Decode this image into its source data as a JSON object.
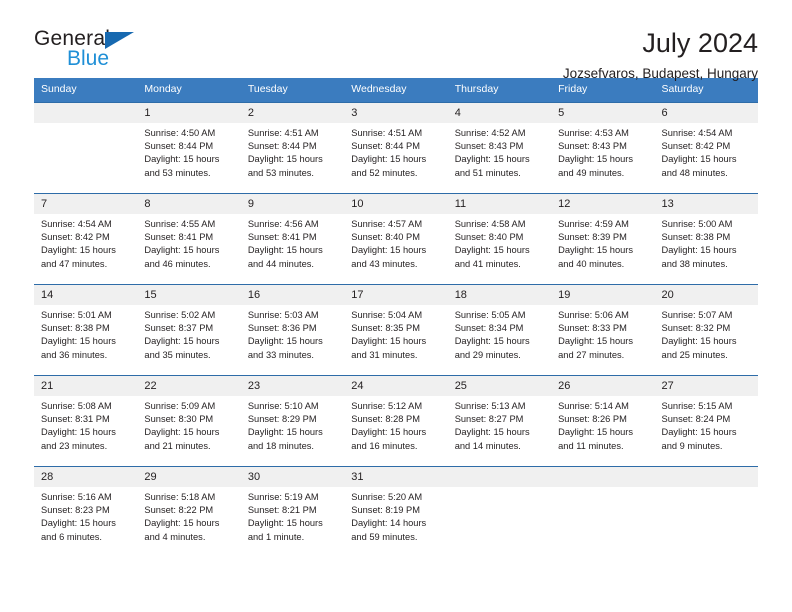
{
  "brand": {
    "name_top": "General",
    "name_bottom": "Blue",
    "accent_color": "#1769b0",
    "accent_color_light": "#1f8fd6"
  },
  "header": {
    "title": "July 2024",
    "subtitle": "Jozsefvaros, Budapest, Hungary"
  },
  "calendar": {
    "header_bg": "#3b7cbf",
    "daynum_bg": "#f0f0f0",
    "rule_color": "#2e6ca8",
    "weekdays": [
      "Sunday",
      "Monday",
      "Tuesday",
      "Wednesday",
      "Thursday",
      "Friday",
      "Saturday"
    ],
    "weeks": [
      [
        {
          "day": "",
          "sunrise": "",
          "sunset": "",
          "daylight1": "",
          "daylight2": ""
        },
        {
          "day": "1",
          "sunrise": "Sunrise: 4:50 AM",
          "sunset": "Sunset: 8:44 PM",
          "daylight1": "Daylight: 15 hours",
          "daylight2": "and 53 minutes."
        },
        {
          "day": "2",
          "sunrise": "Sunrise: 4:51 AM",
          "sunset": "Sunset: 8:44 PM",
          "daylight1": "Daylight: 15 hours",
          "daylight2": "and 53 minutes."
        },
        {
          "day": "3",
          "sunrise": "Sunrise: 4:51 AM",
          "sunset": "Sunset: 8:44 PM",
          "daylight1": "Daylight: 15 hours",
          "daylight2": "and 52 minutes."
        },
        {
          "day": "4",
          "sunrise": "Sunrise: 4:52 AM",
          "sunset": "Sunset: 8:43 PM",
          "daylight1": "Daylight: 15 hours",
          "daylight2": "and 51 minutes."
        },
        {
          "day": "5",
          "sunrise": "Sunrise: 4:53 AM",
          "sunset": "Sunset: 8:43 PM",
          "daylight1": "Daylight: 15 hours",
          "daylight2": "and 49 minutes."
        },
        {
          "day": "6",
          "sunrise": "Sunrise: 4:54 AM",
          "sunset": "Sunset: 8:42 PM",
          "daylight1": "Daylight: 15 hours",
          "daylight2": "and 48 minutes."
        }
      ],
      [
        {
          "day": "7",
          "sunrise": "Sunrise: 4:54 AM",
          "sunset": "Sunset: 8:42 PM",
          "daylight1": "Daylight: 15 hours",
          "daylight2": "and 47 minutes."
        },
        {
          "day": "8",
          "sunrise": "Sunrise: 4:55 AM",
          "sunset": "Sunset: 8:41 PM",
          "daylight1": "Daylight: 15 hours",
          "daylight2": "and 46 minutes."
        },
        {
          "day": "9",
          "sunrise": "Sunrise: 4:56 AM",
          "sunset": "Sunset: 8:41 PM",
          "daylight1": "Daylight: 15 hours",
          "daylight2": "and 44 minutes."
        },
        {
          "day": "10",
          "sunrise": "Sunrise: 4:57 AM",
          "sunset": "Sunset: 8:40 PM",
          "daylight1": "Daylight: 15 hours",
          "daylight2": "and 43 minutes."
        },
        {
          "day": "11",
          "sunrise": "Sunrise: 4:58 AM",
          "sunset": "Sunset: 8:40 PM",
          "daylight1": "Daylight: 15 hours",
          "daylight2": "and 41 minutes."
        },
        {
          "day": "12",
          "sunrise": "Sunrise: 4:59 AM",
          "sunset": "Sunset: 8:39 PM",
          "daylight1": "Daylight: 15 hours",
          "daylight2": "and 40 minutes."
        },
        {
          "day": "13",
          "sunrise": "Sunrise: 5:00 AM",
          "sunset": "Sunset: 8:38 PM",
          "daylight1": "Daylight: 15 hours",
          "daylight2": "and 38 minutes."
        }
      ],
      [
        {
          "day": "14",
          "sunrise": "Sunrise: 5:01 AM",
          "sunset": "Sunset: 8:38 PM",
          "daylight1": "Daylight: 15 hours",
          "daylight2": "and 36 minutes."
        },
        {
          "day": "15",
          "sunrise": "Sunrise: 5:02 AM",
          "sunset": "Sunset: 8:37 PM",
          "daylight1": "Daylight: 15 hours",
          "daylight2": "and 35 minutes."
        },
        {
          "day": "16",
          "sunrise": "Sunrise: 5:03 AM",
          "sunset": "Sunset: 8:36 PM",
          "daylight1": "Daylight: 15 hours",
          "daylight2": "and 33 minutes."
        },
        {
          "day": "17",
          "sunrise": "Sunrise: 5:04 AM",
          "sunset": "Sunset: 8:35 PM",
          "daylight1": "Daylight: 15 hours",
          "daylight2": "and 31 minutes."
        },
        {
          "day": "18",
          "sunrise": "Sunrise: 5:05 AM",
          "sunset": "Sunset: 8:34 PM",
          "daylight1": "Daylight: 15 hours",
          "daylight2": "and 29 minutes."
        },
        {
          "day": "19",
          "sunrise": "Sunrise: 5:06 AM",
          "sunset": "Sunset: 8:33 PM",
          "daylight1": "Daylight: 15 hours",
          "daylight2": "and 27 minutes."
        },
        {
          "day": "20",
          "sunrise": "Sunrise: 5:07 AM",
          "sunset": "Sunset: 8:32 PM",
          "daylight1": "Daylight: 15 hours",
          "daylight2": "and 25 minutes."
        }
      ],
      [
        {
          "day": "21",
          "sunrise": "Sunrise: 5:08 AM",
          "sunset": "Sunset: 8:31 PM",
          "daylight1": "Daylight: 15 hours",
          "daylight2": "and 23 minutes."
        },
        {
          "day": "22",
          "sunrise": "Sunrise: 5:09 AM",
          "sunset": "Sunset: 8:30 PM",
          "daylight1": "Daylight: 15 hours",
          "daylight2": "and 21 minutes."
        },
        {
          "day": "23",
          "sunrise": "Sunrise: 5:10 AM",
          "sunset": "Sunset: 8:29 PM",
          "daylight1": "Daylight: 15 hours",
          "daylight2": "and 18 minutes."
        },
        {
          "day": "24",
          "sunrise": "Sunrise: 5:12 AM",
          "sunset": "Sunset: 8:28 PM",
          "daylight1": "Daylight: 15 hours",
          "daylight2": "and 16 minutes."
        },
        {
          "day": "25",
          "sunrise": "Sunrise: 5:13 AM",
          "sunset": "Sunset: 8:27 PM",
          "daylight1": "Daylight: 15 hours",
          "daylight2": "and 14 minutes."
        },
        {
          "day": "26",
          "sunrise": "Sunrise: 5:14 AM",
          "sunset": "Sunset: 8:26 PM",
          "daylight1": "Daylight: 15 hours",
          "daylight2": "and 11 minutes."
        },
        {
          "day": "27",
          "sunrise": "Sunrise: 5:15 AM",
          "sunset": "Sunset: 8:24 PM",
          "daylight1": "Daylight: 15 hours",
          "daylight2": "and 9 minutes."
        }
      ],
      [
        {
          "day": "28",
          "sunrise": "Sunrise: 5:16 AM",
          "sunset": "Sunset: 8:23 PM",
          "daylight1": "Daylight: 15 hours",
          "daylight2": "and 6 minutes."
        },
        {
          "day": "29",
          "sunrise": "Sunrise: 5:18 AM",
          "sunset": "Sunset: 8:22 PM",
          "daylight1": "Daylight: 15 hours",
          "daylight2": "and 4 minutes."
        },
        {
          "day": "30",
          "sunrise": "Sunrise: 5:19 AM",
          "sunset": "Sunset: 8:21 PM",
          "daylight1": "Daylight: 15 hours",
          "daylight2": "and 1 minute."
        },
        {
          "day": "31",
          "sunrise": "Sunrise: 5:20 AM",
          "sunset": "Sunset: 8:19 PM",
          "daylight1": "Daylight: 14 hours",
          "daylight2": "and 59 minutes."
        },
        {
          "day": "",
          "sunrise": "",
          "sunset": "",
          "daylight1": "",
          "daylight2": ""
        },
        {
          "day": "",
          "sunrise": "",
          "sunset": "",
          "daylight1": "",
          "daylight2": ""
        },
        {
          "day": "",
          "sunrise": "",
          "sunset": "",
          "daylight1": "",
          "daylight2": ""
        }
      ]
    ]
  }
}
